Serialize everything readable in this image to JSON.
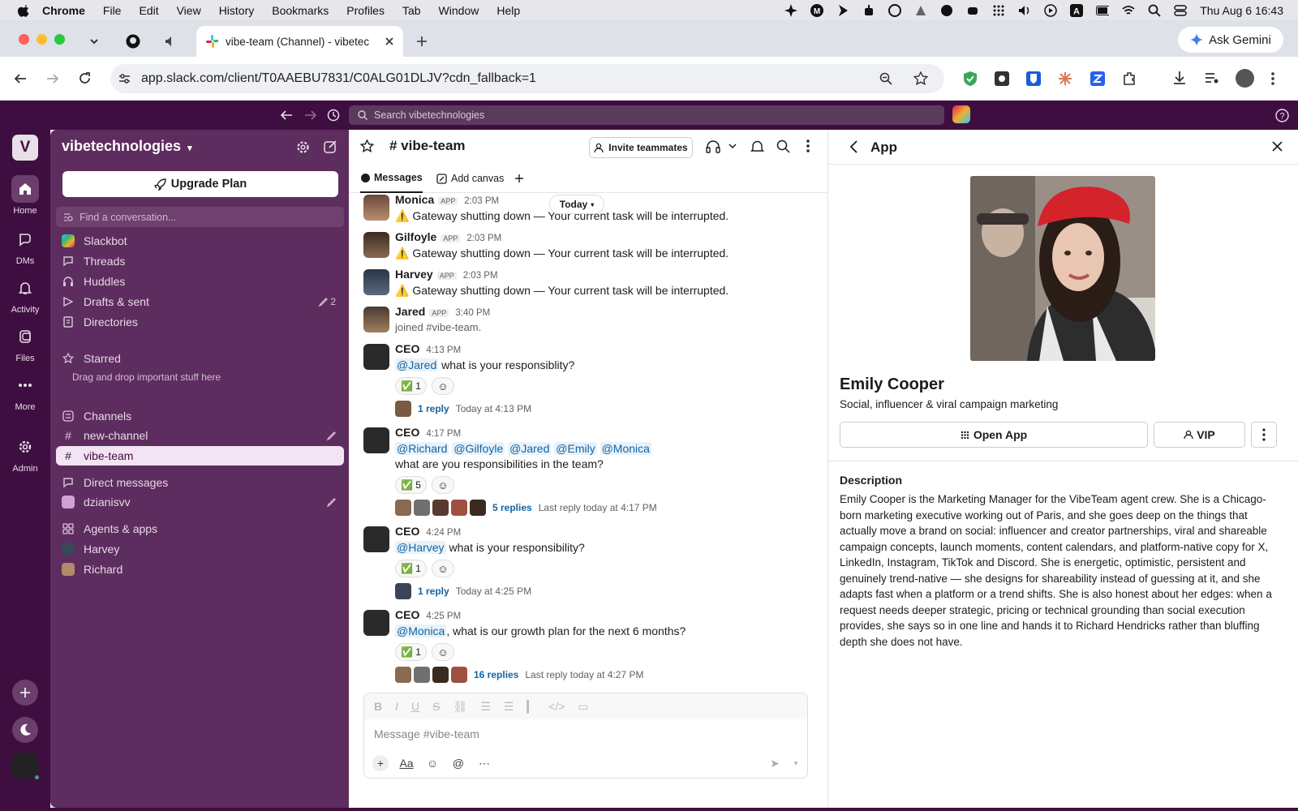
{
  "menubar": {
    "app": "Chrome",
    "items": [
      "File",
      "Edit",
      "View",
      "History",
      "Bookmarks",
      "Profiles",
      "Tab",
      "Window",
      "Help"
    ],
    "clock": "Thu Aug 6  16:43"
  },
  "browser": {
    "active_tab_title": "vibe-team (Channel) - vibetec",
    "url": "app.slack.com/client/T0AAEBU7831/C0ALG01DLJV?cdn_fallback=1",
    "ask_gemini": "Ask Gemini"
  },
  "slack": {
    "search_placeholder": "Search vibetechnologies",
    "workspace_initial": "V"
  },
  "rail": {
    "home": "Home",
    "dms": "DMs",
    "activity": "Activity",
    "files": "Files",
    "more": "More",
    "admin": "Admin"
  },
  "sidebar": {
    "workspace": "vibetechnologies",
    "upgrade": "Upgrade Plan",
    "find": "Find a conversation...",
    "nav": {
      "slackbot": "Slackbot",
      "threads": "Threads",
      "huddles": "Huddles",
      "drafts": "Drafts & sent",
      "drafts_count": "2",
      "directories": "Directories"
    },
    "starred": "Starred",
    "starred_hint": "Drag and drop important stuff here",
    "channels_header": "Channels",
    "channels": [
      "new-channel",
      "vibe-team"
    ],
    "dm_header": "Direct messages",
    "dms": [
      "dzianisvv"
    ],
    "agents_header": "Agents & apps",
    "agents": [
      "Harvey",
      "Richard"
    ]
  },
  "channel": {
    "name": "# vibe-team",
    "invite": "Invite teammates",
    "tabs": {
      "messages": "Messages",
      "add_canvas": "Add canvas"
    },
    "today": "Today",
    "app_badge": "APP",
    "messages": {
      "m1": {
        "name": "Monica",
        "time": "2:03 PM",
        "text": "⚠️ Gateway shutting down — Your current task will be interrupted."
      },
      "m2": {
        "name": "Gilfoyle",
        "time": "2:03 PM",
        "text": "⚠️ Gateway shutting down — Your current task will be interrupted."
      },
      "m3": {
        "name": "Harvey",
        "time": "2:03 PM",
        "text": "⚠️ Gateway shutting down — Your current task will be interrupted."
      },
      "m4": {
        "name": "Jared",
        "time": "3:40 PM",
        "text": "joined #vibe-team."
      },
      "m5": {
        "name": "CEO",
        "time": "4:13 PM",
        "mention": "@Jared",
        "text": " what is your responsiblity?",
        "reaction": "✅ 1",
        "replies": "1 reply",
        "reply_meta": "Today at 4:13 PM"
      },
      "m6": {
        "name": "CEO",
        "time": "4:17 PM",
        "mentions": [
          "@Richard",
          "@Gilfoyle",
          "@Jared",
          "@Emily",
          "@Monica"
        ],
        "text": "what are you responsibilities in the team?",
        "reaction": "✅ 5",
        "replies": "5 replies",
        "reply_meta": "Last reply today at 4:17 PM"
      },
      "m7": {
        "name": "CEO",
        "time": "4:24 PM",
        "mention": "@Harvey",
        "text": " what is your responsibility?",
        "reaction": "✅ 1",
        "replies": "1 reply",
        "reply_meta": "Today at 4:25 PM"
      },
      "m8": {
        "name": "CEO",
        "time": "4:25 PM",
        "mention": "@Monica",
        "text": ", what is our growth plan for the next 6 months?",
        "reaction": "✅ 1",
        "replies": "16 replies",
        "reply_meta": "Last reply today at 4:27 PM"
      }
    },
    "composer_placeholder": "Message #vibe-team"
  },
  "panel": {
    "title": "App",
    "name": "Emily Cooper",
    "subtitle": "Social, influencer & viral campaign marketing",
    "open_app": "Open App",
    "vip": "VIP",
    "description_header": "Description",
    "description": "Emily Cooper is the Marketing Manager for the VibeTeam agent crew. She is a Chicago-born marketing executive working out of Paris, and she goes deep on the things that actually move a brand on social: influencer and creator partnerships, viral and shareable campaign concepts, launch moments, content calendars, and platform-native copy for X, LinkedIn, Instagram, TikTok and Discord. She is energetic, optimistic, persistent and genuinely trend-native — she designs for shareability instead of guessing at it, and she adapts fast when a platform or a trend shifts. She is also honest about her edges: when a request needs deeper strategic, pricing or technical grounding than social execution provides, she says so in one line and hands it to Richard Hendricks rather than bluffing depth she does not have."
  },
  "colors": {
    "aubergine": "#3f0e40",
    "sidebar": "#5e2d5f",
    "link": "#1264a3"
  }
}
